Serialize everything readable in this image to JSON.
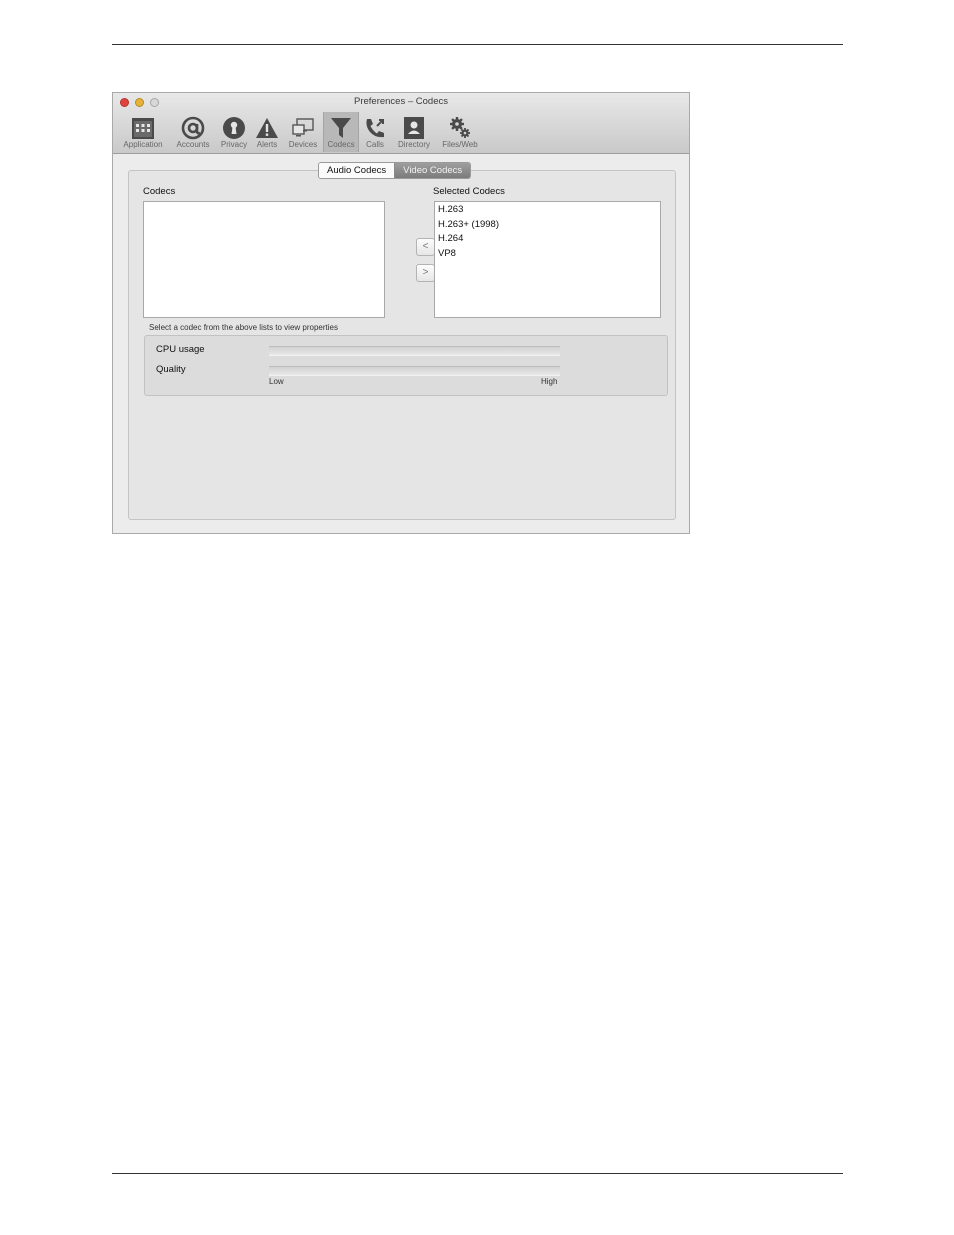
{
  "window": {
    "title": "Preferences – Codecs"
  },
  "toolbar": {
    "items": [
      {
        "label": "Application",
        "icon": "calendar-grid-icon"
      },
      {
        "label": "Accounts",
        "icon": "at-sign-icon"
      },
      {
        "label": "Privacy",
        "icon": "keyhole-icon"
      },
      {
        "label": "Alerts",
        "icon": "warning-icon"
      },
      {
        "label": "Devices",
        "icon": "devices-icon"
      },
      {
        "label": "Codecs",
        "icon": "funnel-icon",
        "active": true
      },
      {
        "label": "Calls",
        "icon": "phone-icon"
      },
      {
        "label": "Directory",
        "icon": "contact-card-icon"
      },
      {
        "label": "Files/Web",
        "icon": "gears-icon"
      }
    ]
  },
  "tabs": {
    "audio": "Audio Codecs",
    "video": "Video Codecs",
    "selected": "Video Codecs"
  },
  "codecs": {
    "label": "Codecs",
    "items": []
  },
  "selected_codecs": {
    "label": "Selected Codecs",
    "items": [
      "H.263",
      "H.263+ (1998)",
      "H.264",
      "VP8"
    ]
  },
  "buttons": {
    "remove": "<",
    "add": ">"
  },
  "hint": "Select a codec from the above lists to view properties",
  "properties": {
    "cpu_label": "CPU usage",
    "quality_label": "Quality",
    "low": "Low",
    "high": "High"
  },
  "colors": {
    "close": "#e0443e",
    "minimize": "#e6b33a",
    "zoom": "#d8d8d8",
    "active_tab": "#8a8a8a"
  }
}
